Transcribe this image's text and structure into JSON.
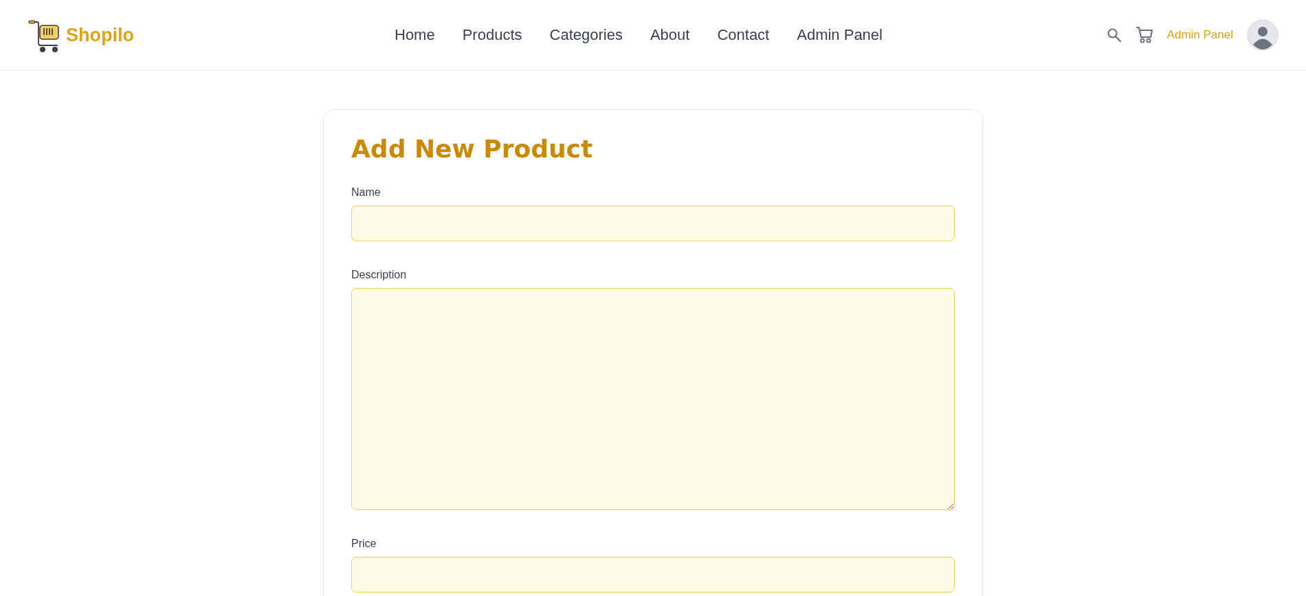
{
  "header": {
    "brand": "Shopilo",
    "nav": [
      {
        "label": "Home",
        "selected": false
      },
      {
        "label": "Products",
        "selected": false
      },
      {
        "label": "Categories",
        "selected": false
      },
      {
        "label": "About",
        "selected": false
      },
      {
        "label": "Contact",
        "selected": false
      },
      {
        "label": "Admin Panel",
        "selected": false
      }
    ],
    "admin_link": "Admin Panel"
  },
  "form": {
    "title": "Add New Product",
    "fields": [
      {
        "label": "Name",
        "kind": "text"
      },
      {
        "label": "Description",
        "kind": "textarea"
      },
      {
        "label": "Price",
        "kind": "text"
      }
    ]
  }
}
